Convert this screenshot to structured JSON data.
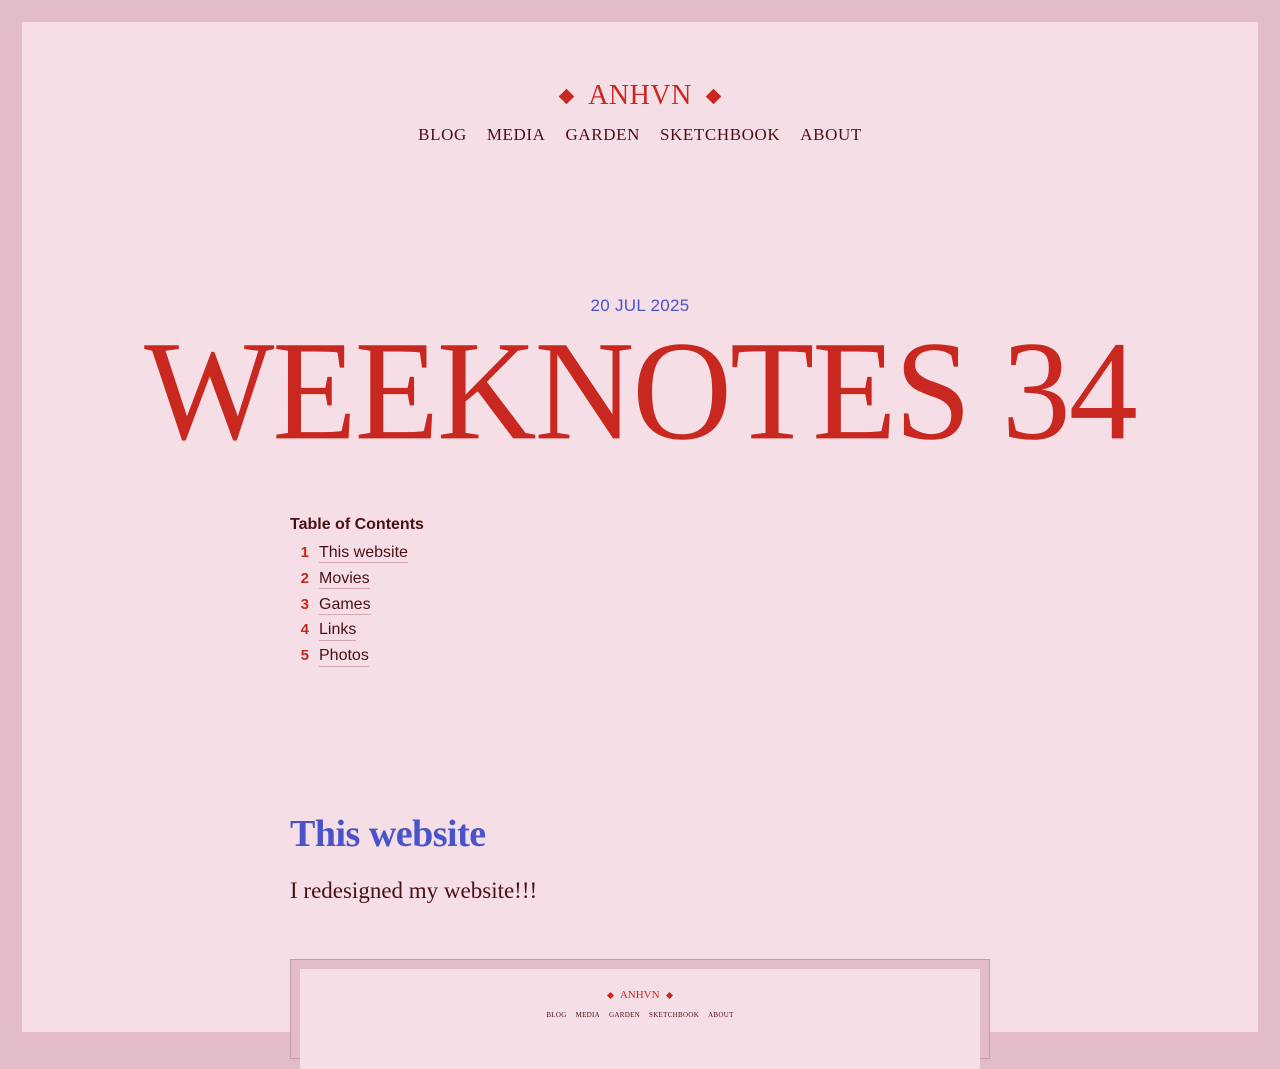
{
  "site": {
    "logo_text": "ANHVN",
    "nav": [
      {
        "label": "BLOG"
      },
      {
        "label": "MEDIA"
      },
      {
        "label": "GARDEN"
      },
      {
        "label": "SKETCHBOOK"
      },
      {
        "label": "ABOUT"
      }
    ]
  },
  "post": {
    "date": "20 JUL 2025",
    "title": "WEEKNOTES 34"
  },
  "toc": {
    "heading": "Table of Contents",
    "items": [
      {
        "num": "1",
        "label": "This website"
      },
      {
        "num": "2",
        "label": "Movies"
      },
      {
        "num": "3",
        "label": "Games"
      },
      {
        "num": "4",
        "label": "Links"
      },
      {
        "num": "5",
        "label": "Photos"
      }
    ]
  },
  "section": {
    "title": "This website",
    "text": "I redesigned my website!!!"
  },
  "screenshot": {
    "logo_text": "ANHVN",
    "nav": [
      "BLOG",
      "MEDIA",
      "GARDEN",
      "SKETCHBOOK",
      "ABOUT"
    ]
  },
  "colors": {
    "accent_red": "#c8281f",
    "accent_blue": "#4a54c9",
    "text_dark": "#4a0f14",
    "page_bg": "#f5dee5",
    "frame_bg": "#e3bcc9"
  }
}
